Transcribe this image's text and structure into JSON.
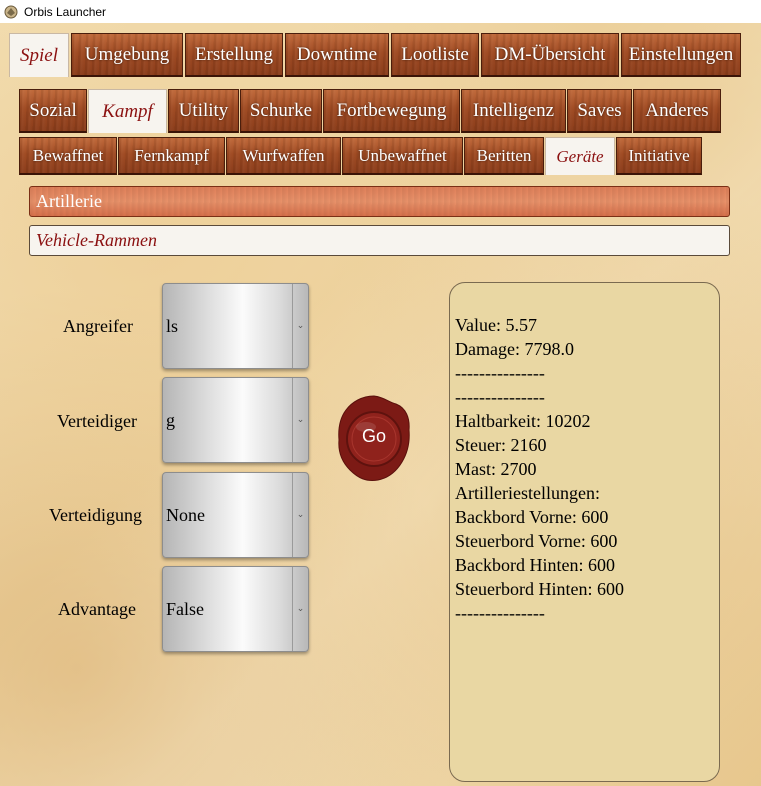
{
  "window": {
    "title": "Orbis Launcher"
  },
  "main_tabs": [
    "Spiel",
    "Umgebung",
    "Erstellung",
    "Downtime",
    "Lootliste",
    "DM-Übersicht",
    "Einstellungen"
  ],
  "category_tabs": [
    "Sozial",
    "Kampf",
    "Utility",
    "Schurke",
    "Fortbewegung",
    "Intelligenz",
    "Saves",
    "Anderes"
  ],
  "sub_tabs": [
    "Bewaffnet",
    "Fernkampf",
    "Wurfwaffen",
    "Unbewaffnet",
    "Beritten",
    "Geräte",
    "Initiative"
  ],
  "active": {
    "main": "Spiel",
    "category": "Kampf",
    "sub": "Geräte"
  },
  "list_items": [
    "Artillerie",
    "Vehicle-Rammen"
  ],
  "form": {
    "attacker": {
      "label": "Angreifer",
      "value": "ls"
    },
    "defender": {
      "label": "Verteidiger",
      "value": "g"
    },
    "defense": {
      "label": "Verteidigung",
      "value": "None"
    },
    "advantage": {
      "label": "Advantage",
      "value": "False"
    }
  },
  "go_button": {
    "label": "Go",
    "color": "#8b1f1a"
  },
  "output_lines": [
    "Value: 5.57",
    "Damage: 7798.0",
    "---------------",
    "---------------",
    "Haltbarkeit: 10202",
    "Steuer: 2160",
    "Mast: 2700",
    "Artilleriestellungen:",
    "Backbord Vorne: 600",
    "Steuerbord Vorne: 600",
    "Backbord Hinten: 600",
    "Steuerbord Hinten: 600",
    "---------------"
  ],
  "colors": {
    "tab_wood": "#9f4a22",
    "active_text": "#8b1111",
    "output_bg": "#e9d7a3"
  }
}
